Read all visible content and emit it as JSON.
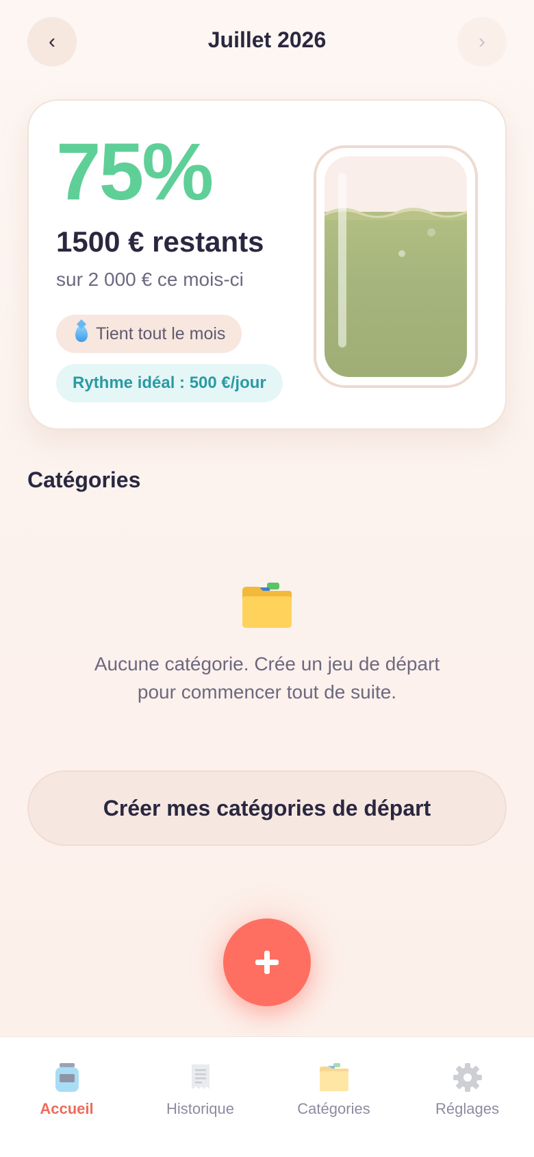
{
  "header": {
    "prev_label": "‹",
    "next_label": "›",
    "month": "Juillet 2026"
  },
  "summary": {
    "percent": "75%",
    "fill_fraction": 0.75,
    "remaining": "1500 € restants",
    "total": "sur 2 000 € ce mois-ci",
    "status_icon": "water-drop-icon",
    "status": "Tient tout le mois",
    "rhythm": "Rythme idéal : 500 €/jour"
  },
  "categories": {
    "title": "Catégories",
    "empty_icon": "folder-icon",
    "empty_text_line1": "Aucune catégorie. Crée un jeu de départ",
    "empty_text_line2": "pour commencer tout de suite.",
    "create_button": "Créer mes catégories de départ"
  },
  "fab": {
    "icon": "plus-icon"
  },
  "bottom_nav": {
    "items": [
      {
        "label": "Accueil",
        "icon": "jar-icon",
        "active": true
      },
      {
        "label": "Historique",
        "icon": "receipt-icon",
        "active": false
      },
      {
        "label": "Catégories",
        "icon": "folder-icon",
        "active": false
      },
      {
        "label": "Réglages",
        "icon": "gear-icon",
        "active": false
      }
    ]
  },
  "colors": {
    "accent_green": "#5fcf98",
    "accent_coral": "#ff6f61",
    "rhythm_teal": "#2a9aa3"
  }
}
